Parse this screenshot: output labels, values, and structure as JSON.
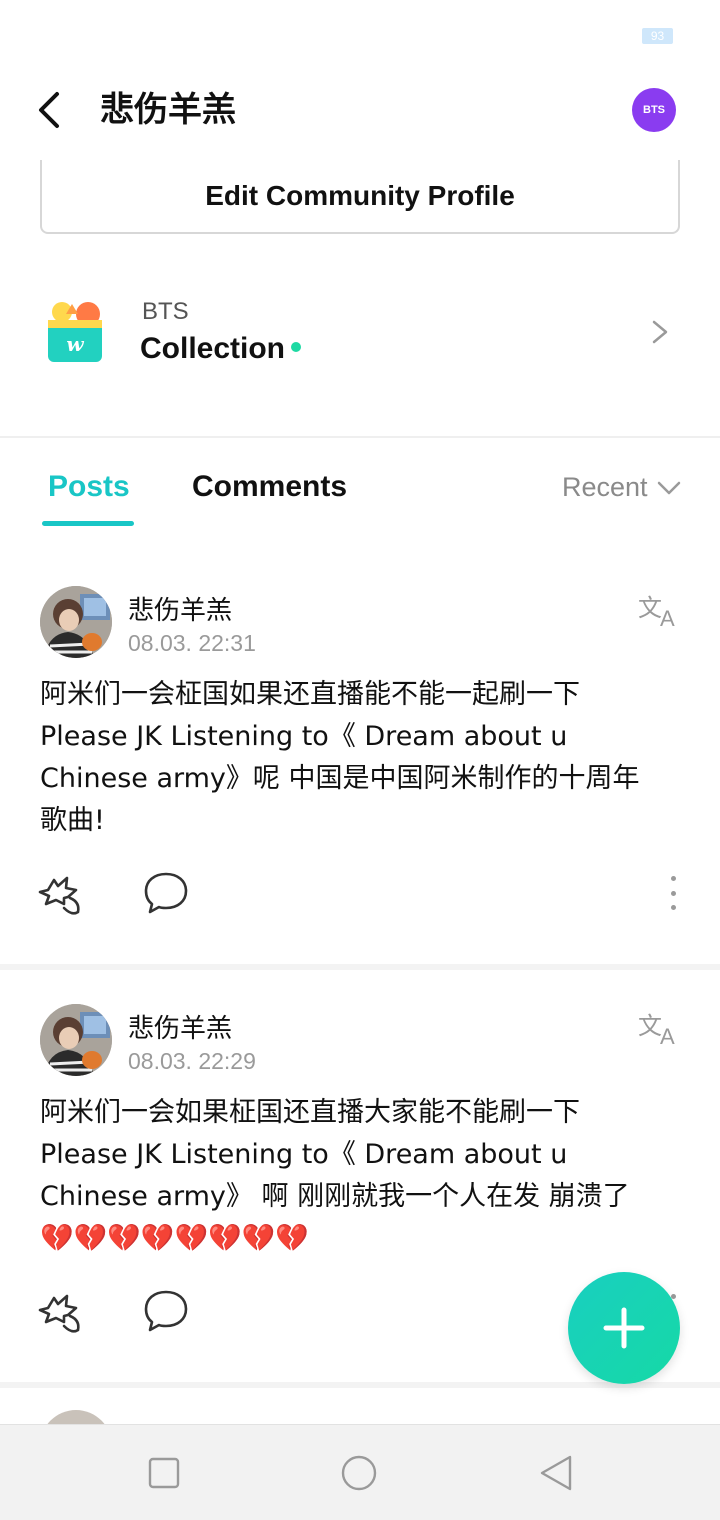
{
  "status_bar": {
    "battery": "93"
  },
  "header": {
    "title": "悲伤羊羔",
    "community_badge": "BTS"
  },
  "profile": {
    "edit_button": "Edit Community Profile"
  },
  "collection": {
    "community": "BTS",
    "title": "Collection"
  },
  "tabs": {
    "posts": "Posts",
    "comments": "Comments",
    "sort": "Recent"
  },
  "posts": [
    {
      "author": "悲伤羊羔",
      "date": "08.03. 22:31",
      "body": "阿米们一会柾国如果还直播能不能一起刷一下\nPlease JK Listening to《 Dream about u\nChinese army》呢 中国是中国阿米制作的十周年\n歌曲!"
    },
    {
      "author": "悲伤羊羔",
      "date": "08.03. 22:29",
      "body": "阿米们一会如果柾国还直播大家能不能刷一下\nPlease JK Listening to《 Dream about u\nChinese army》 啊 刚刚就我一个人在发 崩溃了\n💔💔💔💔💔💔💔💔"
    }
  ],
  "colors": {
    "accent": "#19c6c6",
    "fab": "#16d9a6",
    "community": "#8a3cf0"
  },
  "icons": [
    "back-arrow-icon",
    "translate-icon",
    "like-icon",
    "comment-icon",
    "more-icon",
    "plus-icon",
    "nav-recent-icon",
    "nav-home-icon",
    "nav-back-icon"
  ]
}
